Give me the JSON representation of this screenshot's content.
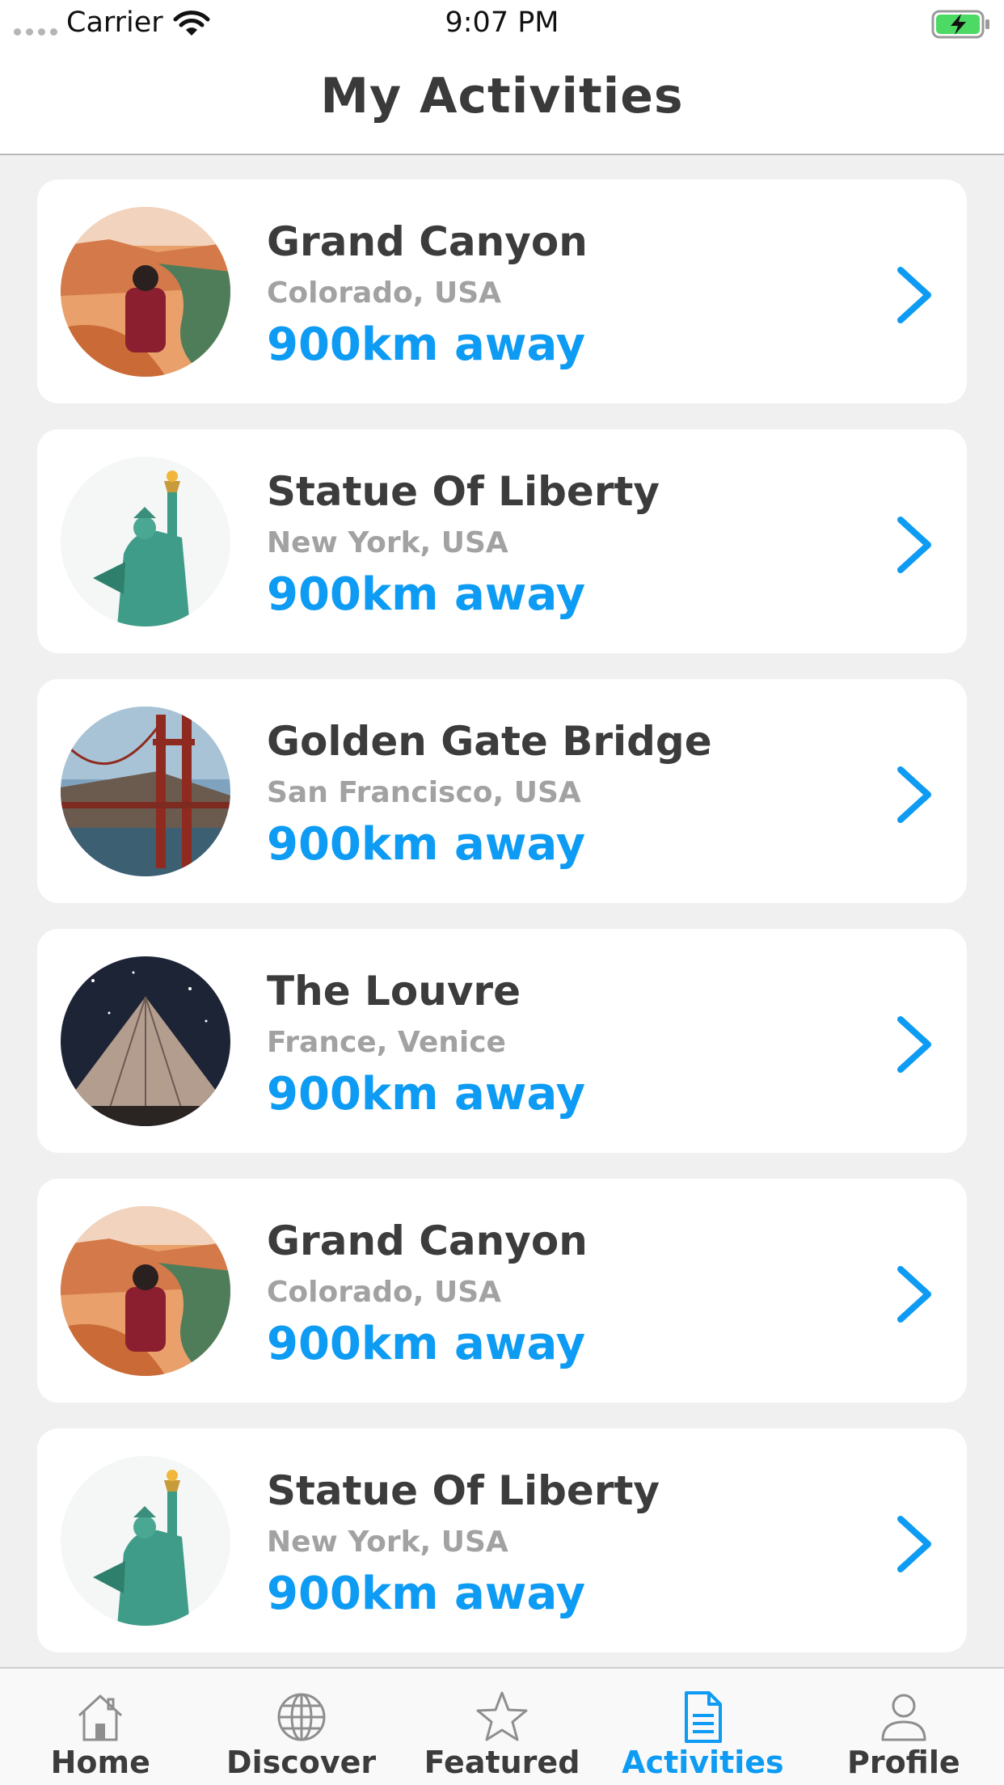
{
  "status_bar": {
    "carrier": "Carrier",
    "time": "9:07 PM"
  },
  "header": {
    "title": "My Activities"
  },
  "colors": {
    "accent": "#0d9bf3",
    "title_text": "#3c3c3c",
    "subtitle_text": "#a2a2a2",
    "background": "#f0f0f0"
  },
  "activities": [
    {
      "name": "Grand Canyon",
      "location": "Colorado, USA",
      "distance": "900km away",
      "image": "grand-canyon"
    },
    {
      "name": "Statue Of Liberty",
      "location": "New York, USA",
      "distance": "900km away",
      "image": "statue-of-liberty"
    },
    {
      "name": "Golden Gate Bridge",
      "location": "San Francisco, USA",
      "distance": "900km away",
      "image": "golden-gate-bridge"
    },
    {
      "name": "The Louvre",
      "location": "France, Venice",
      "distance": "900km away",
      "image": "the-louvre"
    },
    {
      "name": "Grand Canyon",
      "location": "Colorado, USA",
      "distance": "900km away",
      "image": "grand-canyon"
    },
    {
      "name": "Statue Of Liberty",
      "location": "New York, USA",
      "distance": "900km away",
      "image": "statue-of-liberty"
    }
  ],
  "tab_bar": {
    "active": "activities",
    "tabs": [
      {
        "id": "home",
        "label": "Home",
        "icon": "home-icon"
      },
      {
        "id": "discover",
        "label": "Discover",
        "icon": "globe-icon"
      },
      {
        "id": "featured",
        "label": "Featured",
        "icon": "star-icon"
      },
      {
        "id": "activities",
        "label": "Activities",
        "icon": "document-icon"
      },
      {
        "id": "profile",
        "label": "Profile",
        "icon": "person-icon"
      }
    ]
  }
}
